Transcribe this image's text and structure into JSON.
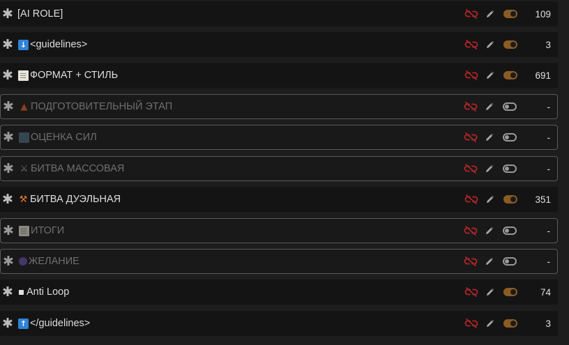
{
  "accent": {
    "toggle_on": "#8a5c24",
    "link_icon": "#b0262a"
  },
  "entries": [
    {
      "title": "[AI ROLE]",
      "emoji_icon": "",
      "enabled": true,
      "count": "109"
    },
    {
      "title": "<guidelines>",
      "emoji_icon": "down-arrow-icon",
      "enabled": true,
      "count": "3"
    },
    {
      "title": "ФОРМАТ + СТИЛЬ",
      "emoji_icon": "memo-icon",
      "enabled": true,
      "count": "691"
    },
    {
      "title": "ПОДГОТОВИТЕЛЬНЫЙ ЭТАП",
      "emoji_icon": "fire-icon",
      "enabled": false,
      "count": "-"
    },
    {
      "title": "ОЦЕНКА СИЛ",
      "emoji_icon": "bar-chart-icon",
      "enabled": false,
      "count": "-"
    },
    {
      "title": "БИТВА МАССОВАЯ",
      "emoji_icon": "crossed-swords-icon",
      "enabled": false,
      "count": "-"
    },
    {
      "title": "БИТВА ДУЭЛЬНАЯ",
      "emoji_icon": "hammer-icon",
      "enabled": true,
      "count": "351"
    },
    {
      "title": "ИТОГИ",
      "emoji_icon": "memo-icon",
      "enabled": false,
      "count": "-"
    },
    {
      "title": "ЖЕЛАНИЕ",
      "emoji_icon": "crystal-ball-icon",
      "enabled": false,
      "count": "-"
    },
    {
      "title": "Anti Loop",
      "emoji_icon": "square-icon",
      "enabled": true,
      "count": "74"
    },
    {
      "title": "</guidelines>",
      "emoji_icon": "up-arrow-icon",
      "enabled": true,
      "count": "3"
    }
  ]
}
